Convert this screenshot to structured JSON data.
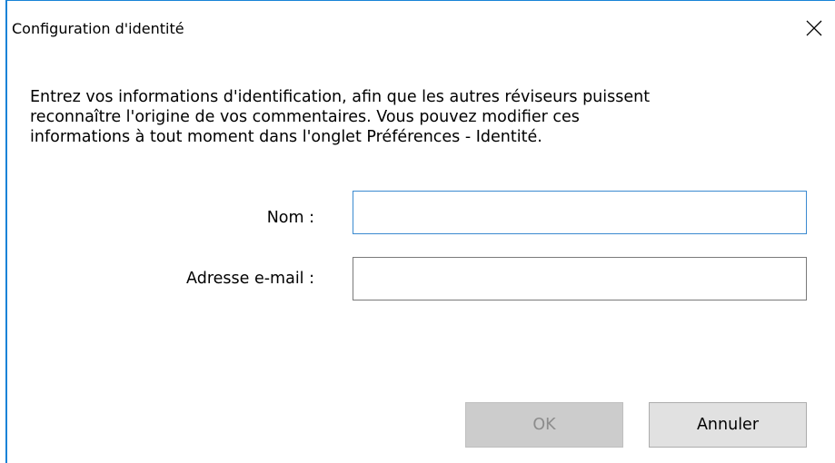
{
  "window": {
    "title": "Configuration d'identité",
    "close_icon": "close-icon",
    "accent_color": "#1883d7"
  },
  "description": {
    "lines": [
      "Entrez vos informations d'identification, afin que les autres réviseurs puissent",
      "reconnaître l'origine de vos commentaires. Vous pouvez modifier ces",
      "informations à tout moment dans l'onglet Préférences - Identité."
    ]
  },
  "form": {
    "name_label": "Nom :",
    "name_value": "",
    "email_label": "Adresse e-mail :",
    "email_value": ""
  },
  "buttons": {
    "ok_label": "OK",
    "ok_enabled": false,
    "cancel_label": "Annuler"
  }
}
